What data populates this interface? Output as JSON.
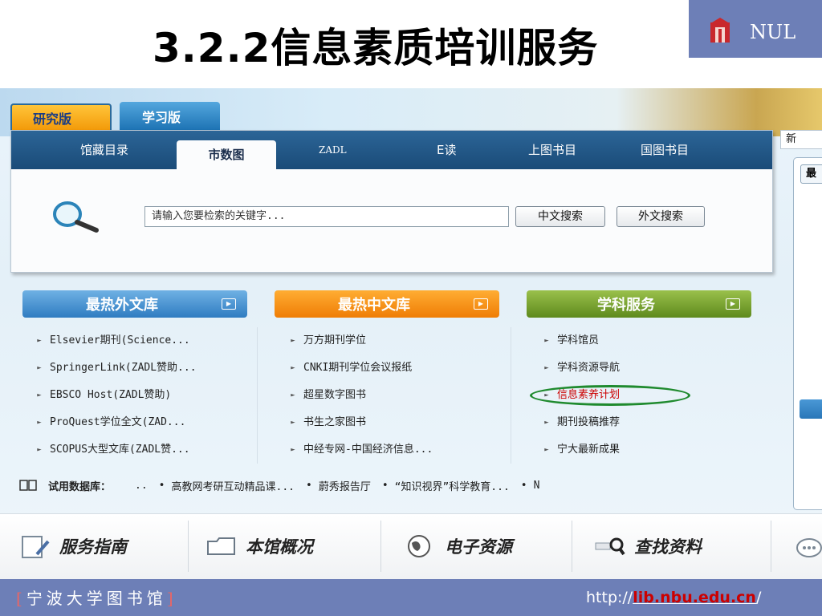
{
  "slide": {
    "title": "3.2.2信息素质培训服务",
    "logo_text": "NUL"
  },
  "site": {
    "version_tabs": [
      "研究版",
      "学习版"
    ],
    "nav_tabs": [
      "馆藏目录",
      "市数图",
      "ZADL",
      "E读",
      "上图书目",
      "国图书目"
    ],
    "active_nav": "市数图",
    "search": {
      "placeholder": "请输入您要检索的关键字...",
      "btn_cn": "中文搜索",
      "btn_foreign": "外文搜索"
    },
    "right_tab": "新",
    "right_box_head": "最",
    "columns": [
      {
        "header": "最热外文库",
        "items": [
          "Elsevier期刊(Science...",
          "SpringerLink(ZADL赞助...",
          "EBSCO Host(ZADL赞助)",
          "ProQuest学位全文(ZAD...",
          "SCOPUS大型文库(ZADL赞..."
        ]
      },
      {
        "header": "最热中文库",
        "items": [
          "万方期刊学位",
          "CNKI期刊学位会议报纸",
          "超星数字图书",
          "书生之家图书",
          "中经专网-中国经济信息..."
        ]
      },
      {
        "header": "学科服务",
        "items": [
          "学科馆员",
          "学科资源导航",
          "信息素养计划",
          "期刊投稿推荐",
          "宁大最新成果"
        ],
        "highlight_index": 2,
        "highlight_color": "#cc0000"
      }
    ],
    "trial": {
      "label": "试用数据库：",
      "dots": "..",
      "items": [
        "高教网考研互动精品课...",
        "蔚秀报告厅",
        "“知识视界”科学教育...",
        "N"
      ]
    },
    "bottom_menu": [
      "服务指南",
      "本馆概况",
      "电子资源",
      "查找资料"
    ]
  },
  "footer": {
    "library_name": "宁波大学图书馆",
    "bracket_open": "[",
    "bracket_close": "]",
    "url_prefix": "http://",
    "url_domain": "lib.nbu.edu.cn",
    "url_suffix": "/"
  },
  "colors": {
    "band": "#6d7fb7",
    "nav": "#1a4b78",
    "highlight_ring": "#1f8a2e"
  }
}
